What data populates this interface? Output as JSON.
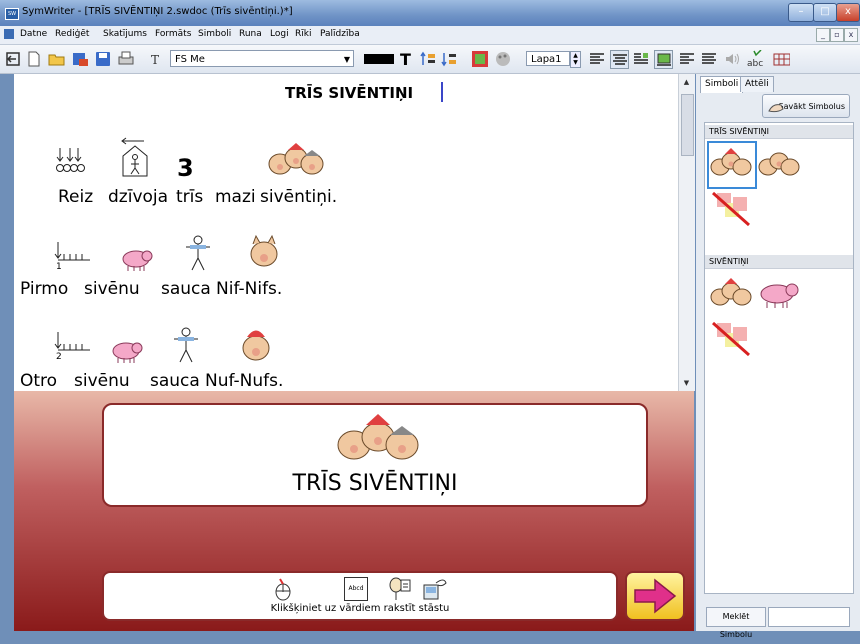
{
  "window": {
    "title": "SymWriter - [TRĪS SIVĒNTIŅI 2.swdoc (Trīs sivēntiņi.)*]",
    "app_icon_text": "SW",
    "minimize": "–",
    "maximize": "□",
    "close": "x"
  },
  "menu": {
    "items": [
      "Datne",
      "Rediģēt",
      "Skatījums",
      "Formāts",
      "Simboli",
      "Runa",
      "Logi",
      "Rīki",
      "Palīdzība"
    ],
    "mdi_minimize": "_",
    "mdi_restore": "▫",
    "mdi_close": "x"
  },
  "toolbar": {
    "font": "FS Me",
    "page": "Lapa1"
  },
  "document": {
    "title": "TRĪS SIVĒNTIŅI",
    "lines": [
      {
        "words": [
          "Reiz",
          "dzīvoja",
          "trīs",
          "mazi",
          "sivēntiņi."
        ],
        "number_symbol": "3"
      },
      {
        "words": [
          "Pirmo",
          "sivēnu",
          "sauca",
          "Nif-Nifs."
        ],
        "ordinal": "1"
      },
      {
        "words": [
          "Otro",
          "sivēnu",
          "sauca",
          "Nuf-Nufs."
        ],
        "ordinal": "2"
      }
    ]
  },
  "preview": {
    "title": "TRĪS SIVĒNTIŅI",
    "hint": "Klikšķiniet uz vārdiem rakstīt stāstu",
    "hint_icon_label": "Abcd"
  },
  "side_panel": {
    "tabs": [
      "Simboli",
      "Attēli"
    ],
    "collect_button": "Savākt Simbolus",
    "groups": [
      {
        "label": "TRĪS SIVĒNTIŅI"
      },
      {
        "label": "SIVĒNTIŅI"
      }
    ],
    "search_button": "Meklēt Simbolu"
  },
  "colors": {
    "accent": "#3a8ad8",
    "caret": "#3a46c8",
    "panel_dark": "#8a1a1a",
    "next_arrow": "#e0308a"
  }
}
